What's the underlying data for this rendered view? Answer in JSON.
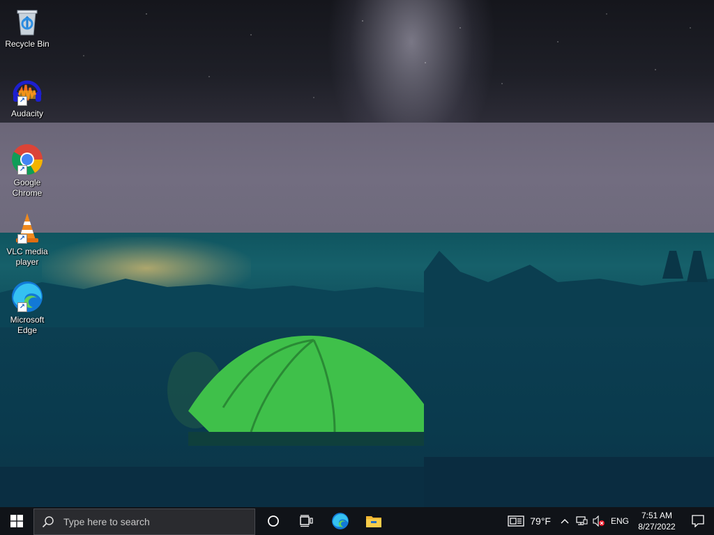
{
  "desktop": {
    "icons": [
      {
        "label": "Recycle Bin",
        "icon": "recycle-bin-icon"
      },
      {
        "label": "Audacity",
        "icon": "audacity-icon"
      },
      {
        "label": "Google Chrome",
        "icon": "chrome-icon"
      },
      {
        "label": "VLC media player",
        "icon": "vlc-icon"
      },
      {
        "label": "Microsoft Edge",
        "icon": "edge-icon"
      }
    ]
  },
  "taskbar": {
    "search_placeholder": "Type here to search",
    "pinned": [
      "cortana-icon",
      "task-view-icon",
      "edge-icon",
      "file-explorer-icon"
    ],
    "weather": {
      "temp": "79°F",
      "icon": "weather-icon"
    },
    "tray": {
      "language": "ENG",
      "time": "7:51 AM",
      "date": "8/27/2022"
    }
  },
  "colors": {
    "taskbar_bg": "#101318",
    "search_bg": "#2a2b2f",
    "accent": "#1e90ff"
  }
}
